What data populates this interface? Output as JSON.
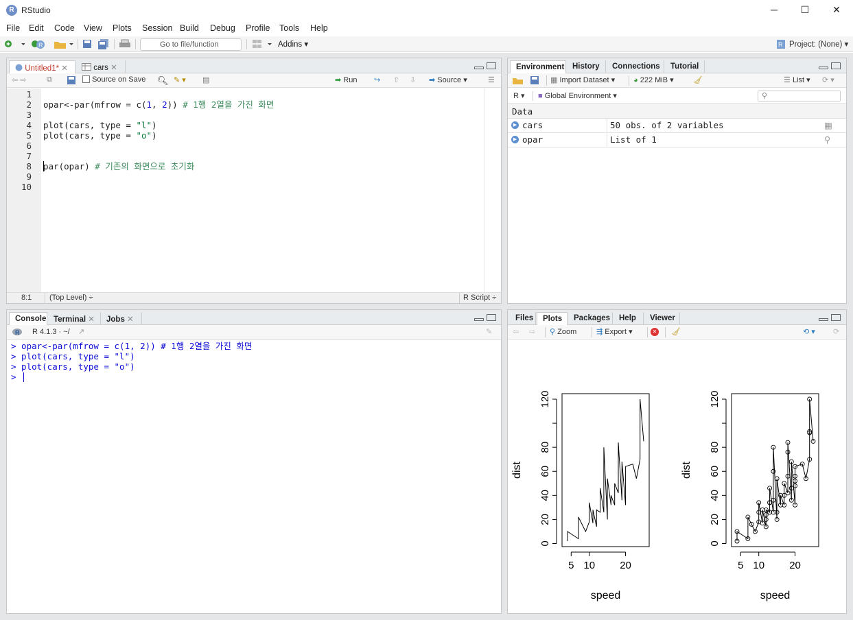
{
  "app": {
    "title": "RStudio",
    "logo_letter": "R"
  },
  "window_controls": {
    "minimize": "─",
    "maximize": "☐",
    "close": "✕"
  },
  "menu": [
    "File",
    "Edit",
    "Code",
    "View",
    "Plots",
    "Session",
    "Build",
    "Debug",
    "Profile",
    "Tools",
    "Help"
  ],
  "toolbar": {
    "goto_placeholder": "Go to file/function",
    "addins": "Addins",
    "project": "Project: (None)"
  },
  "editor": {
    "tabs": [
      {
        "label": "Untitled1*",
        "modified": true
      },
      {
        "label": "cars"
      }
    ],
    "source_on_save": "Source on Save",
    "run": "Run",
    "source": "Source",
    "lines": [
      "1",
      "2",
      "3",
      "4",
      "5",
      "6",
      "7",
      "8",
      "9",
      "10"
    ],
    "code": [
      "",
      "opar<-par(mfrow = c(1, 2)) # 1행 2열을 가진 화면",
      "",
      "plot(cars, type = \"l\")",
      "plot(cars, type = \"o\")",
      "",
      "",
      "par(opar) # 기존의 화면으로 초기화",
      "",
      ""
    ],
    "status_pos": "8:1",
    "status_scope": "(Top Level) ÷",
    "status_type": "R Script ÷"
  },
  "console": {
    "tabs": [
      "Console",
      "Terminal",
      "Jobs"
    ],
    "r_version": "R 4.1.3 · ~/",
    "lines": [
      "> opar<-par(mfrow = c(1, 2)) # 1행 2열을 가진 화면",
      "> plot(cars, type = \"l\")",
      "> plot(cars, type = \"o\")",
      "> "
    ]
  },
  "environment": {
    "tabs": [
      "Environment",
      "History",
      "Connections",
      "Tutorial"
    ],
    "import_dataset": "Import Dataset",
    "memory": "222 MiB",
    "list_view": "List",
    "r_lang": "R",
    "scope": "Global Environment",
    "section": "Data",
    "rows": [
      {
        "name": "cars",
        "value": "50 obs. of 2 variables"
      },
      {
        "name": "opar",
        "value": "List of  1"
      }
    ]
  },
  "files_pane": {
    "tabs": [
      "Files",
      "Plots",
      "Packages",
      "Help",
      "Viewer"
    ],
    "zoom": "Zoom",
    "export": "Export"
  },
  "chart_data": [
    {
      "type": "line",
      "xlabel": "speed",
      "ylabel": "dist",
      "xticks": [
        5,
        10,
        20
      ],
      "yticks": [
        0,
        20,
        40,
        60,
        80,
        100,
        120
      ],
      "xlim": [
        4,
        25
      ],
      "ylim": [
        2,
        120
      ],
      "x": [
        4,
        4,
        7,
        7,
        8,
        9,
        10,
        10,
        10,
        11,
        11,
        12,
        12,
        12,
        12,
        13,
        13,
        13,
        13,
        14,
        14,
        14,
        14,
        15,
        15,
        15,
        16,
        16,
        17,
        17,
        17,
        18,
        18,
        18,
        18,
        19,
        19,
        19,
        20,
        20,
        20,
        20,
        20,
        22,
        23,
        24,
        24,
        24,
        24,
        25
      ],
      "y": [
        2,
        10,
        4,
        22,
        16,
        10,
        18,
        26,
        34,
        17,
        28,
        14,
        20,
        24,
        28,
        26,
        34,
        34,
        46,
        26,
        36,
        60,
        80,
        20,
        26,
        54,
        32,
        40,
        32,
        40,
        50,
        42,
        56,
        76,
        84,
        36,
        46,
        68,
        32,
        48,
        52,
        56,
        64,
        66,
        54,
        70,
        92,
        93,
        120,
        85
      ],
      "points": false
    },
    {
      "type": "line",
      "xlabel": "speed",
      "ylabel": "dist",
      "xticks": [
        5,
        10,
        20
      ],
      "yticks": [
        0,
        20,
        40,
        60,
        80,
        100,
        120
      ],
      "xlim": [
        4,
        25
      ],
      "ylim": [
        2,
        120
      ],
      "x": [
        4,
        4,
        7,
        7,
        8,
        9,
        10,
        10,
        10,
        11,
        11,
        12,
        12,
        12,
        12,
        13,
        13,
        13,
        13,
        14,
        14,
        14,
        14,
        15,
        15,
        15,
        16,
        16,
        17,
        17,
        17,
        18,
        18,
        18,
        18,
        19,
        19,
        19,
        20,
        20,
        20,
        20,
        20,
        22,
        23,
        24,
        24,
        24,
        24,
        25
      ],
      "y": [
        2,
        10,
        4,
        22,
        16,
        10,
        18,
        26,
        34,
        17,
        28,
        14,
        20,
        24,
        28,
        26,
        34,
        34,
        46,
        26,
        36,
        60,
        80,
        20,
        26,
        54,
        32,
        40,
        32,
        40,
        50,
        42,
        56,
        76,
        84,
        36,
        46,
        68,
        32,
        48,
        52,
        56,
        64,
        66,
        54,
        70,
        92,
        93,
        120,
        85
      ],
      "points": true
    }
  ]
}
